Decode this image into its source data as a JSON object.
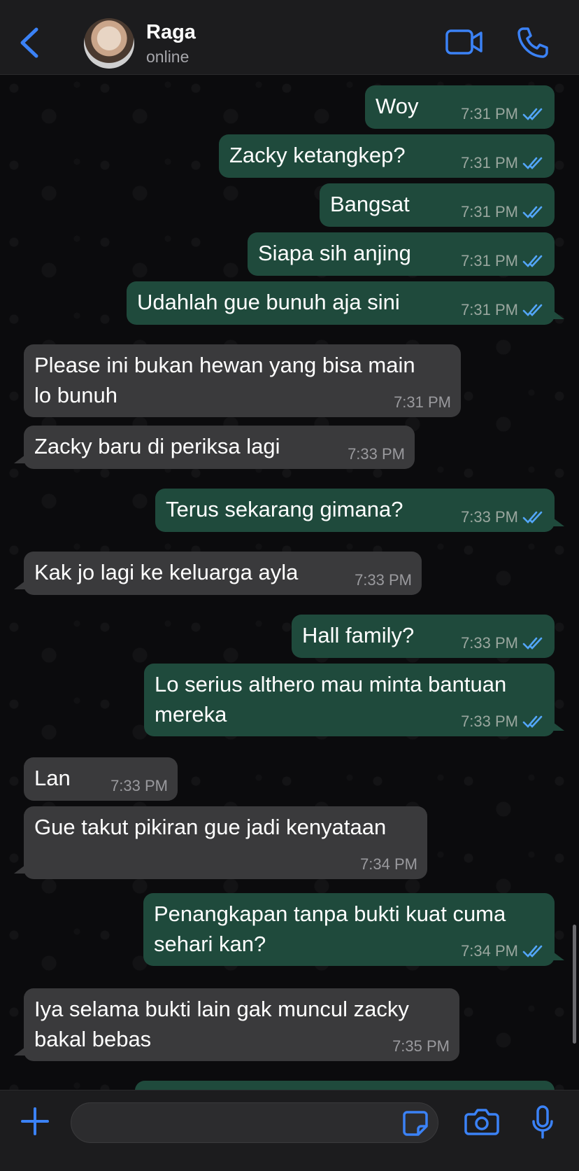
{
  "header": {
    "contact_name": "Raga",
    "status": "online"
  },
  "accent_color": "#3b82f6",
  "messages": [
    {
      "dir": "out",
      "text": "Woy",
      "time": "7:31 PM",
      "read": true
    },
    {
      "dir": "out",
      "text": "Zacky ketangkep?",
      "time": "7:31 PM",
      "read": true
    },
    {
      "dir": "out",
      "text": "Bangsat",
      "time": "7:31 PM",
      "read": true
    },
    {
      "dir": "out",
      "text": "Siapa sih anjing",
      "time": "7:31 PM",
      "read": true
    },
    {
      "dir": "out",
      "text": "Udahlah gue bunuh aja sini",
      "time": "7:31 PM",
      "read": true
    },
    {
      "dir": "in",
      "text_lines": [
        "Please ini bukan hewan yang bisa main",
        "lo bunuh"
      ],
      "time": "7:31 PM"
    },
    {
      "dir": "in",
      "text": "Zacky baru di periksa lagi",
      "time": "7:33 PM"
    },
    {
      "dir": "out",
      "text": "Terus sekarang gimana?",
      "time": "7:33 PM",
      "read": true
    },
    {
      "dir": "in",
      "text": "Kak jo lagi ke keluarga ayla",
      "time": "7:33 PM"
    },
    {
      "dir": "out",
      "text": "Hall family?",
      "time": "7:33 PM",
      "read": true
    },
    {
      "dir": "out",
      "text_lines": [
        "Lo serius althero mau minta bantuan",
        "mereka"
      ],
      "time": "7:33 PM",
      "read": true
    },
    {
      "dir": "in",
      "text": "Lan",
      "time": "7:33 PM"
    },
    {
      "dir": "in",
      "text": "Gue takut pikiran gue jadi kenyataan",
      "time": "7:34 PM"
    },
    {
      "dir": "out",
      "text_lines": [
        "Penangkapan tanpa bukti kuat cuma",
        "sehari kan?"
      ],
      "time": "7:34 PM",
      "read": true
    },
    {
      "dir": "in",
      "text_lines": [
        "Iya selama bukti lain gak muncul zacky",
        "bakal bebas"
      ],
      "time": "7:35 PM"
    }
  ],
  "composer": {
    "placeholder": ""
  }
}
